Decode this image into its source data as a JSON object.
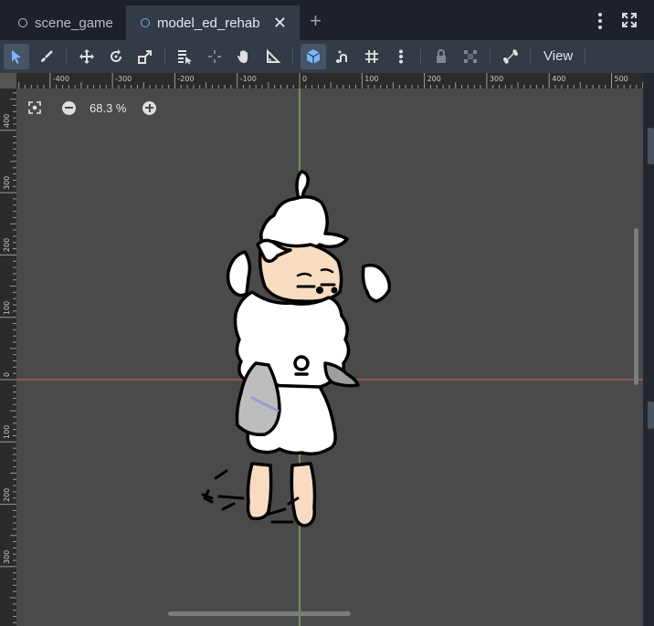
{
  "tabs": [
    {
      "label": "scene_game"
    },
    {
      "label": "model_ed_rehab"
    }
  ],
  "toolbar": {
    "view_label": "View"
  },
  "zoom": {
    "value": "68.3 %"
  },
  "rulers": {
    "top": [
      "-400",
      "-300",
      "-200",
      "-100",
      "0",
      "100",
      "200",
      "300",
      "400",
      "500"
    ],
    "left": [
      "400",
      "300",
      "200",
      "100",
      "0",
      "100",
      "200",
      "300"
    ]
  },
  "colors": {
    "canvas_bg": "#4a4a4a",
    "x_axis": "#e05a6a",
    "y_axis": "#9fdc60",
    "active_tool": "#465468"
  }
}
